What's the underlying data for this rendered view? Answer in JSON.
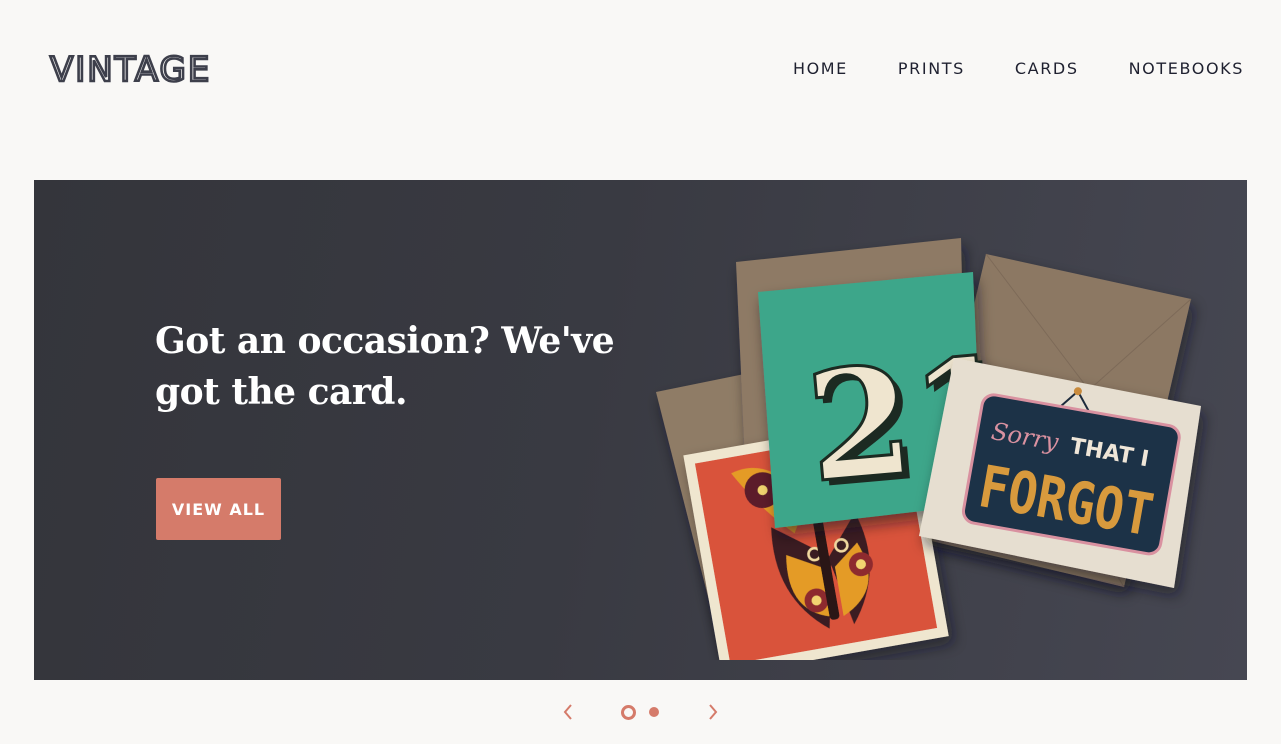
{
  "brand": {
    "logo_text": "VINTAGE"
  },
  "nav": {
    "items": [
      {
        "label": "HOME"
      },
      {
        "label": "PRINTS"
      },
      {
        "label": "CARDS"
      },
      {
        "label": "NOTEBOOKS"
      }
    ]
  },
  "hero": {
    "title": "Got an occasion? We've got the card.",
    "cta_label": "VIEW ALL",
    "image_alt": "Greeting cards with envelopes",
    "cards": {
      "number_card_text": "21",
      "sorry_script": "Sorry",
      "sorry_line": "THAT I",
      "sorry_big": "FORGOT"
    }
  },
  "carousel": {
    "prev_icon": "chevron-left-icon",
    "next_icon": "chevron-right-icon",
    "slide_count": 2,
    "active_slide": 1
  },
  "colors": {
    "accent": "#d57b6a",
    "hero_bg": "#393a42",
    "nav_text": "#1f2130",
    "page_bg": "#f9f8f6"
  }
}
